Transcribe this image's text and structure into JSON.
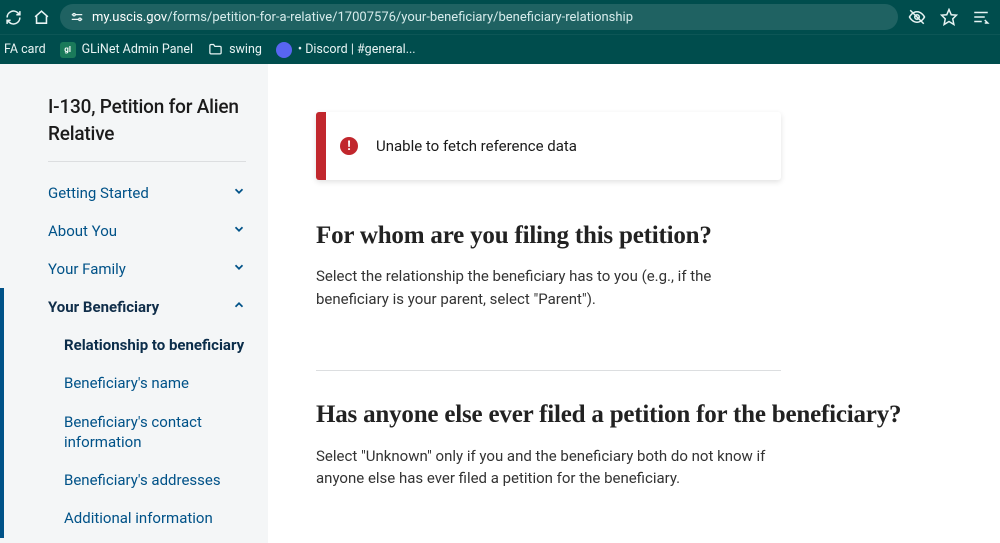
{
  "browser": {
    "url_host": "my.uscis.gov",
    "url_path": "/forms/petition-for-a-relative/17007576/your-beneficiary/beneficiary-relationship",
    "bookmarks": [
      {
        "label": "FA card"
      },
      {
        "label": "GLiNet Admin Panel"
      },
      {
        "label": "swing"
      },
      {
        "label": "• Discord | #general..."
      }
    ]
  },
  "sidebar": {
    "title": "I-130, Petition for Alien Relative",
    "nav": [
      {
        "label": "Getting Started",
        "expanded": false
      },
      {
        "label": "About You",
        "expanded": false
      },
      {
        "label": "Your Family",
        "expanded": false
      },
      {
        "label": "Your Beneficiary",
        "expanded": true,
        "active": true
      }
    ],
    "subitems": [
      {
        "label": "Relationship to beneficiary",
        "current": true
      },
      {
        "label": "Beneficiary's name"
      },
      {
        "label": "Beneficiary's contact information"
      },
      {
        "label": "Beneficiary's addresses"
      },
      {
        "label": "Additional information"
      }
    ]
  },
  "content": {
    "alert": "Unable to fetch reference data",
    "q1_heading": "For whom are you filing this petition?",
    "q1_body": "Select the relationship the beneficiary has to you (e.g., if the beneficiary is your parent, select \"Parent\").",
    "q2_heading": "Has anyone else ever filed a petition for the beneficiary?",
    "q2_body": "Select \"Unknown\" only if you and the beneficiary both do not know if anyone else has ever filed a petition for the beneficiary."
  }
}
